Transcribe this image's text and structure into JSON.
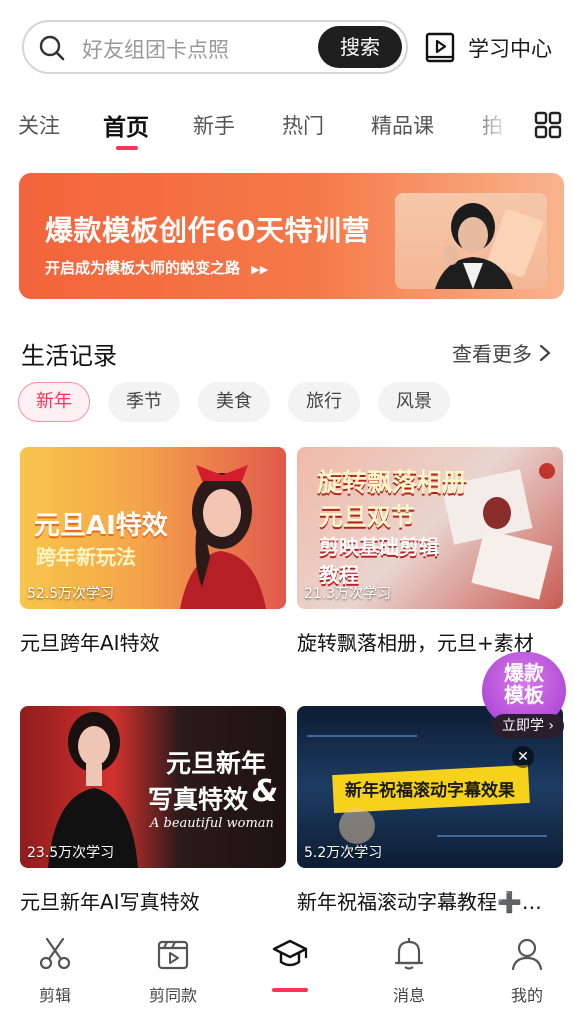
{
  "search": {
    "placeholder": "好友组团卡点照",
    "button": "搜索"
  },
  "learn_center": {
    "label": "学习中心",
    "icon": "video-book-icon"
  },
  "tabs": [
    "关注",
    "首页",
    "新手",
    "热门",
    "精品课",
    "拍"
  ],
  "active_tab": "首页",
  "banner": {
    "title": "爆款模板创作60天特训营",
    "subtitle": "开启成为模板大师的蜕变之路",
    "arrows": "▶▶"
  },
  "section": {
    "title": "生活记录",
    "see_more": "查看更多"
  },
  "chips": [
    "新年",
    "季节",
    "美食",
    "旅行",
    "风景"
  ],
  "cards": [
    {
      "title": "元旦跨年AI特效",
      "views": "52.5万次学习",
      "overlay": [
        "元旦AI特效",
        "跨年新玩法"
      ]
    },
    {
      "title": "旋转飘落相册，元旦+素材",
      "views": "21.3万次学习",
      "overlay": [
        "旋转飘落相册",
        "元旦双节",
        "剪映基础剪辑",
        "教程"
      ]
    },
    {
      "title": "元旦新年AI写真特效",
      "views": "23.5万次学习",
      "overlay": [
        "元旦新年",
        "写真特效",
        "&",
        "A beautiful woman"
      ]
    },
    {
      "title": "新年祝福滚动字幕教程➕…",
      "views": "5.2万次学习",
      "overlay": [
        "新年祝福滚动字幕效果"
      ]
    }
  ],
  "float_promo": {
    "text": "爆款模板",
    "button": "立即学 ›",
    "close": "✕"
  },
  "bottom_nav": [
    {
      "label": "剪辑",
      "icon": "scissors-icon"
    },
    {
      "label": "剪同款",
      "icon": "clapper-play-icon"
    },
    {
      "label": "",
      "icon": "graduation-cap-icon"
    },
    {
      "label": "消息",
      "icon": "bell-icon"
    },
    {
      "label": "我的",
      "icon": "person-icon"
    }
  ],
  "colors": {
    "accent": "#ff3357",
    "banner": "#f3643b",
    "dark_button": "#1f1f1f"
  }
}
